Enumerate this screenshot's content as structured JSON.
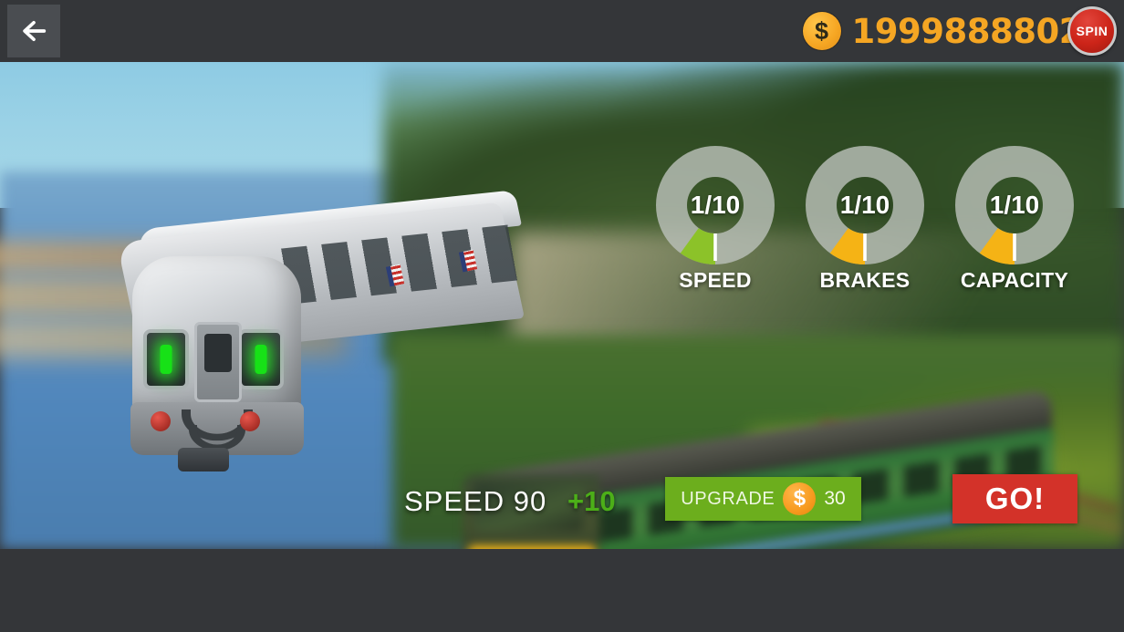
{
  "topbar": {
    "back_icon": "back-arrow-icon",
    "coin_icon": "coin-icon",
    "coin_symbol": "$",
    "coin_amount": "1999888802",
    "spin_label": "SPIN"
  },
  "gauges": [
    {
      "label": "SPEED",
      "value": "1/10",
      "level": 1,
      "max": 10,
      "arc_color": "#8cc229",
      "track_color": "#b9c0b8"
    },
    {
      "label": "BRAKES",
      "value": "1/10",
      "level": 1,
      "max": 10,
      "arc_color": "#f5b315",
      "track_color": "#b9c0b8"
    },
    {
      "label": "CAPACITY",
      "value": "1/10",
      "level": 1,
      "max": 10,
      "arc_color": "#f5b315",
      "track_color": "#b9c0b8"
    }
  ],
  "action": {
    "stat_label": "SPEED",
    "stat_value": "90",
    "stat_text": "SPEED  90",
    "delta": "+10",
    "upgrade_label": "UPGRADE",
    "upgrade_coin_symbol": "$",
    "upgrade_price": "30",
    "go_label": "GO!"
  },
  "colors": {
    "topbar_bg": "#343639",
    "coin_gold": "#f5a623",
    "spin_red": "#cc2418",
    "upgrade_green": "#6cae1d",
    "go_red": "#d33229",
    "delta_green": "#4caf18"
  }
}
